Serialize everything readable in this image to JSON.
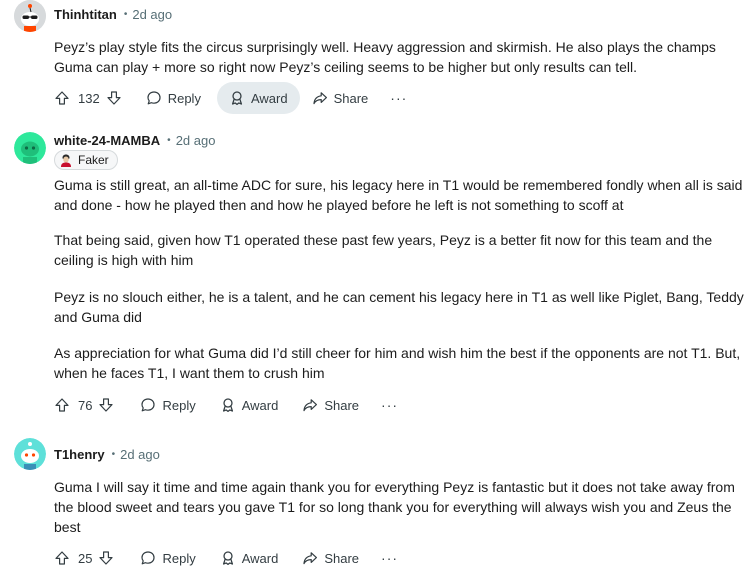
{
  "colors": {
    "text": "#1c1c1c",
    "muted": "#576f76",
    "action_text": "#333d42",
    "active_bg": "#e5ebee",
    "avatar1_bg": "#d7dadc",
    "avatar2_bg": "#2ee89b",
    "avatar3_bg": "#5ee0d9"
  },
  "comments": [
    {
      "username": "Thinhtitan",
      "separator": "•",
      "time": "2d ago",
      "avatar_icon": "snoo-sunglasses-avatar-icon",
      "paragraphs": [
        "Peyz’s play style fits the circus surprisingly well. Heavy aggression and skirmish. He also plays the champs Guma can play + more so right now Peyz’s ceiling seems to be higher but only results can tell."
      ],
      "votes": "132",
      "reply": "Reply",
      "award": "Award",
      "share": "Share",
      "more": "···"
    },
    {
      "username": "white-24-MAMBA",
      "separator": "•",
      "time": "2d ago",
      "avatar_icon": "snoo-green-avatar-icon",
      "flair": "Faker",
      "flair_icon": "faker-portrait-icon",
      "paragraphs": [
        "Guma is still great, an all-time ADC for sure, his legacy here in T1 would be remembered fondly when all is said and done - how he played then and how he played before he left is not something to scoff at",
        "That being said, given how T1 operated these past few years, Peyz is a better fit now for this team and the ceiling is high with him",
        "Peyz is no slouch either, he is a talent, and he can cement his legacy here in T1 as well like Piglet, Bang, Teddy and Guma did",
        "As appreciation for what Guma did I’d still cheer for him and wish him the best if the opponents are not T1. But, when he faces T1, I want them to crush him"
      ],
      "votes": "76",
      "reply": "Reply",
      "award": "Award",
      "share": "Share",
      "more": "···"
    },
    {
      "username": "T1henry",
      "separator": "•",
      "time": "2d ago",
      "avatar_icon": "snoo-teal-avatar-icon",
      "paragraphs": [
        "Guma I will say it time and time again thank you for everything Peyz is fantastic but it does not take away from the blood sweet and tears you gave T1 for so long thank you for everything will always wish you and Zeus the best"
      ],
      "votes": "25",
      "reply": "Reply",
      "award": "Award",
      "share": "Share",
      "more": "···"
    }
  ]
}
